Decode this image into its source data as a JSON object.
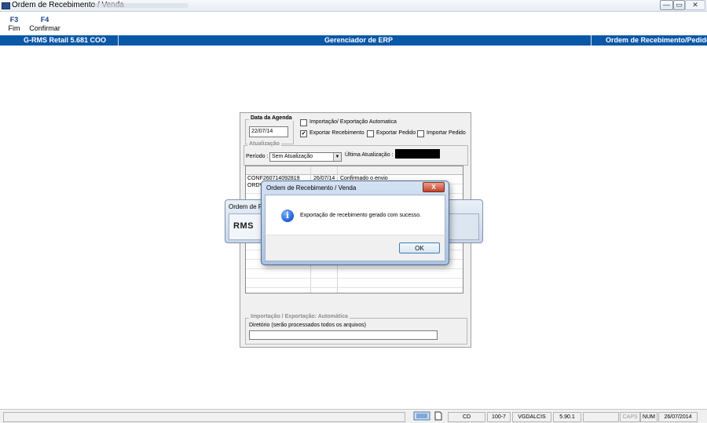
{
  "window": {
    "title": "Ordem de Recebimento / Venda",
    "minimize": "—",
    "restore": "▭",
    "close": "✕"
  },
  "toolbar": {
    "keys": [
      {
        "key": "F3",
        "label": "Fim"
      },
      {
        "key": "F4",
        "label": "Confirmar"
      }
    ]
  },
  "header": {
    "left": "G-RMS Retail 5.681 COO",
    "center": "Gerenciador de ERP",
    "right": "Ordem de Recebimento/Pedido"
  },
  "form": {
    "agenda_title": "Data da Agenda",
    "agenda_date": "22/07/14",
    "auto_import_export": {
      "label": "Importação/ Exportação Automatica",
      "checked": false
    },
    "export_recebimento": {
      "label": "Exportar Recebimento",
      "checked": true
    },
    "export_pedido": {
      "label": "Exportar Pedido",
      "checked": false
    },
    "import_pedido": {
      "label": "Importar Pedido",
      "checked": false
    },
    "atualizacao_title": "Atualização",
    "periodo_label": "Período :",
    "periodo_value": "Sem Atualização",
    "ultima_label": "Última Atualização :",
    "grid_rows": [
      {
        "col1": "CONF260714092819",
        "col2": "26/07/14",
        "col3": "Confirmado o envio"
      },
      {
        "col1": "ORDV",
        "col2": "",
        "col3": ""
      }
    ],
    "auto_group_title": "Importação / Exportação: Automática",
    "diretorio_label": "Diretório (serão processados todos os arquivos)",
    "diretorio_value": ""
  },
  "splash": {
    "title": "Ordem de Re",
    "logo": "RMS"
  },
  "dialog": {
    "title": "Ordem de Recebimento / Venda",
    "close": "X",
    "icon": "info-icon",
    "message": "Exportação de recebimento gerado com sucesso.",
    "ok": "OK"
  },
  "statusbar": {
    "cells": [
      "CD",
      "100-7",
      "VGDALCIS",
      "5.90.1",
      "",
      "CAPS",
      "NUM",
      "26/07/2014"
    ]
  },
  "colors": {
    "header_bg": "#0a58a8",
    "fkey": "#1a3f8f",
    "info_icon": "#1d5fd0"
  }
}
